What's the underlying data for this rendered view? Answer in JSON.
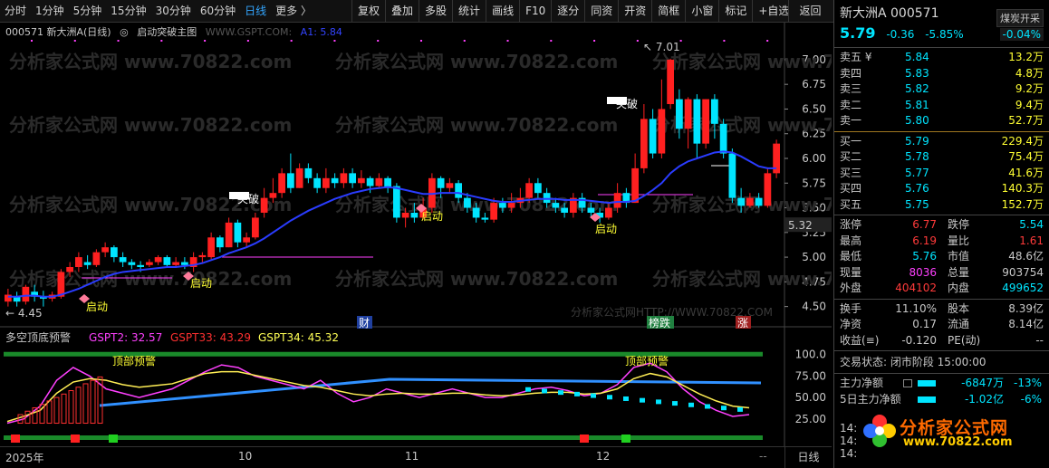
{
  "toolbar": {
    "periods": [
      "分时",
      "1分钟",
      "5分钟",
      "15分钟",
      "30分钟",
      "60分钟",
      "日线",
      "更多 〉"
    ],
    "active_period": "日线",
    "buttons": [
      "复权",
      "叠加",
      "多股",
      "统计",
      "画线",
      "F10",
      "逐分",
      "同资",
      "开资",
      "简框",
      "小窗",
      "标记",
      "+自选"
    ],
    "back": "返回"
  },
  "main_chart": {
    "stock_label": "000571 新大洲A(日线)",
    "indicator_name": "启动突破主图",
    "indicator_src": "WWW.GSPT.COM:",
    "a1_label": "A1: 5.84",
    "y_ticks": [
      "7.00",
      "6.75",
      "6.50",
      "6.25",
      "6.00",
      "5.75",
      "5.50",
      "5.25",
      "5.00",
      "4.75",
      "4.50"
    ],
    "current_price_tag": "5.32",
    "high_mark": "7.01",
    "low_mark": "4.45",
    "annotations": [
      "突破",
      "突破",
      "启动",
      "启动",
      "启动",
      "启动"
    ],
    "event_tags": [
      "财",
      "榜跌",
      "涨"
    ],
    "watermark": "分析家公式网 www.70822.com",
    "watermark_small": "分析家公式网HTTP://WWW.70822.COM"
  },
  "sub_chart": {
    "name": "多空顶底预警",
    "gspt2": "GSPT2: 32.57",
    "gspt33": "GSPT33: 43.29",
    "gspt34": "GSPT34: 45.32",
    "y_ticks": [
      "100.0",
      "75.00",
      "50.00",
      "25.00"
    ],
    "warnings": [
      "顶部预警",
      "顶部预警"
    ]
  },
  "x_axis": [
    "2025年",
    "10",
    "11",
    "12"
  ],
  "x_right": "日线",
  "panel": {
    "name": "新大洲A 000571",
    "sector": "煤炭开采",
    "price": "5.79",
    "change": "-0.36",
    "change_pct": "-5.85%",
    "sector_pct": "-0.04%",
    "asks": [
      {
        "label": "卖五 ¥",
        "price": "5.84",
        "vol": "13.2万"
      },
      {
        "label": "卖四",
        "price": "5.83",
        "vol": "4.8万"
      },
      {
        "label": "卖三",
        "price": "5.82",
        "vol": "9.2万"
      },
      {
        "label": "卖二",
        "price": "5.81",
        "vol": "9.4万"
      },
      {
        "label": "卖一",
        "price": "5.80",
        "vol": "52.7万"
      }
    ],
    "bids": [
      {
        "label": "买一",
        "price": "5.79",
        "vol": "229.4万"
      },
      {
        "label": "买二",
        "price": "5.78",
        "vol": "75.4万"
      },
      {
        "label": "买三",
        "price": "5.77",
        "vol": "41.6万"
      },
      {
        "label": "买四",
        "price": "5.76",
        "vol": "140.3万"
      },
      {
        "label": "买五",
        "price": "5.75",
        "vol": "152.7万"
      }
    ],
    "stats": [
      {
        "l1": "涨停",
        "v1": "6.77",
        "l2": "跌停",
        "v2": "5.54"
      },
      {
        "l1": "最高",
        "v1": "6.19",
        "l2": "量比",
        "v2": "1.61"
      },
      {
        "l1": "最低",
        "v1": "5.76",
        "l2": "市值",
        "v2": "48.6亿"
      },
      {
        "l1": "现量",
        "v1": "8036",
        "l2": "总量",
        "v2": "903754"
      },
      {
        "l1": "外盘",
        "v1": "404102",
        "l2": "内盘",
        "v2": "499652"
      }
    ],
    "stats2": [
      {
        "l1": "换手",
        "v1": "11.10%",
        "l2": "股本",
        "v2": "8.39亿"
      },
      {
        "l1": "净资",
        "v1": "0.17",
        "l2": "流通",
        "v2": "8.14亿"
      },
      {
        "l1": "收益(≡)",
        "v1": "-0.120",
        "l2": "PE(动)",
        "v2": "--"
      }
    ],
    "trade_status": "交易状态: 闭市阶段 15:00:00",
    "flow1_label": "主力净额",
    "flow1_val": "-6847万",
    "flow1_pct": "-13%",
    "flow2_label": "5日主力净额",
    "flow2_val": "-1.02亿",
    "flow2_pct": "-6%",
    "logo_text": "分析家公式网",
    "logo_url": "www.70822.com",
    "time_stub1": "14:",
    "time_stub2": "14:",
    "time_stub3": "14:"
  },
  "chart_data": {
    "type": "candlestick",
    "ylim": [
      4.35,
      7.1
    ],
    "candles": [
      [
        4.55,
        4.62,
        4.5,
        4.68
      ],
      [
        4.6,
        4.55,
        4.5,
        4.65
      ],
      [
        4.55,
        4.7,
        4.52,
        4.72
      ],
      [
        4.65,
        4.6,
        4.55,
        4.72
      ],
      [
        4.6,
        4.58,
        4.5,
        4.66
      ],
      [
        4.58,
        4.62,
        4.55,
        4.65
      ],
      [
        4.6,
        4.85,
        4.58,
        4.88
      ],
      [
        4.85,
        4.9,
        4.8,
        4.95
      ],
      [
        4.9,
        5.0,
        4.85,
        5.05
      ],
      [
        4.95,
        4.92,
        4.88,
        5.02
      ],
      [
        4.92,
        5.05,
        4.9,
        5.08
      ],
      [
        5.05,
        5.1,
        5.0,
        5.15
      ],
      [
        5.1,
        5.0,
        4.95,
        5.12
      ],
      [
        5.0,
        4.95,
        4.9,
        5.05
      ],
      [
        4.95,
        4.92,
        4.88,
        4.98
      ],
      [
        4.92,
        4.9,
        4.85,
        4.96
      ],
      [
        4.92,
        4.95,
        4.9,
        4.98
      ],
      [
        4.95,
        5.0,
        4.92,
        5.02
      ],
      [
        5.0,
        4.92,
        4.9,
        5.02
      ],
      [
        4.92,
        4.95,
        4.9,
        5.0
      ],
      [
        4.95,
        4.92,
        4.88,
        5.0
      ],
      [
        4.9,
        5.0,
        4.85,
        5.05
      ],
      [
        5.0,
        5.02,
        4.95,
        5.05
      ],
      [
        5.0,
        5.2,
        4.98,
        5.25
      ],
      [
        5.2,
        5.1,
        5.05,
        5.22
      ],
      [
        5.1,
        5.35,
        5.1,
        5.4
      ],
      [
        5.35,
        5.15,
        5.1,
        5.38
      ],
      [
        5.15,
        5.2,
        5.1,
        5.25
      ],
      [
        5.2,
        5.4,
        5.18,
        5.45
      ],
      [
        5.45,
        5.6,
        5.4,
        5.7
      ],
      [
        5.6,
        5.65,
        5.55,
        5.8
      ],
      [
        5.65,
        5.85,
        5.6,
        5.9
      ],
      [
        5.85,
        5.7,
        5.65,
        6.05
      ],
      [
        5.7,
        5.9,
        5.7,
        5.95
      ],
      [
        5.9,
        5.8,
        5.75,
        5.95
      ],
      [
        5.8,
        5.7,
        5.65,
        5.85
      ],
      [
        5.7,
        5.8,
        5.65,
        5.9
      ],
      [
        5.8,
        5.75,
        5.7,
        5.85
      ],
      [
        5.75,
        5.85,
        5.7,
        5.9
      ],
      [
        5.85,
        5.75,
        5.7,
        5.9
      ],
      [
        5.75,
        5.8,
        5.7,
        5.88
      ],
      [
        5.8,
        5.72,
        5.65,
        5.82
      ],
      [
        5.72,
        5.8,
        5.7,
        5.85
      ],
      [
        5.8,
        5.7,
        5.65,
        5.82
      ],
      [
        5.72,
        5.4,
        5.35,
        5.75
      ],
      [
        5.4,
        5.45,
        5.3,
        5.5
      ],
      [
        5.45,
        5.4,
        5.35,
        5.55
      ],
      [
        5.4,
        5.5,
        5.38,
        5.6
      ],
      [
        5.5,
        5.8,
        5.45,
        5.85
      ],
      [
        5.8,
        5.7,
        5.6,
        5.82
      ],
      [
        5.7,
        5.75,
        5.65,
        5.8
      ],
      [
        5.75,
        5.6,
        5.55,
        5.78
      ],
      [
        5.6,
        5.5,
        5.45,
        5.65
      ],
      [
        5.5,
        5.4,
        5.35,
        5.55
      ],
      [
        5.4,
        5.38,
        5.35,
        5.45
      ],
      [
        5.38,
        5.55,
        5.35,
        5.6
      ],
      [
        5.55,
        5.5,
        5.45,
        5.6
      ],
      [
        5.5,
        5.55,
        5.45,
        5.65
      ],
      [
        5.55,
        5.6,
        5.5,
        5.7
      ],
      [
        5.6,
        5.75,
        5.55,
        5.8
      ],
      [
        5.75,
        5.65,
        5.6,
        5.8
      ],
      [
        5.65,
        5.55,
        5.5,
        5.7
      ],
      [
        5.55,
        5.5,
        5.45,
        5.6
      ],
      [
        5.5,
        5.45,
        5.4,
        5.55
      ],
      [
        5.45,
        5.6,
        5.4,
        5.65
      ],
      [
        5.6,
        5.5,
        5.45,
        5.65
      ],
      [
        5.5,
        5.45,
        5.4,
        5.55
      ],
      [
        5.45,
        5.4,
        5.35,
        5.5
      ],
      [
        5.4,
        5.5,
        5.38,
        5.55
      ],
      [
        5.5,
        5.65,
        5.45,
        5.75
      ],
      [
        5.65,
        5.55,
        5.5,
        5.7
      ],
      [
        5.55,
        5.9,
        5.55,
        6.05
      ],
      [
        5.9,
        6.4,
        5.85,
        6.55
      ],
      [
        6.4,
        6.05,
        6.0,
        6.5
      ],
      [
        6.05,
        6.5,
        6.0,
        6.8
      ],
      [
        6.55,
        7.0,
        6.5,
        7.01
      ],
      [
        6.6,
        6.3,
        6.2,
        6.7
      ],
      [
        6.3,
        6.6,
        6.1,
        6.62
      ],
      [
        6.6,
        6.15,
        6.0,
        6.65
      ],
      [
        6.15,
        6.6,
        6.1,
        6.6
      ],
      [
        6.6,
        6.35,
        6.2,
        6.65
      ],
      [
        6.35,
        6.05,
        6.0,
        6.4
      ],
      [
        6.05,
        5.6,
        5.55,
        6.1
      ],
      [
        5.6,
        5.52,
        5.45,
        5.7
      ],
      [
        5.52,
        5.6,
        5.5,
        5.65
      ],
      [
        5.6,
        5.52,
        5.5,
        5.65
      ],
      [
        5.52,
        5.85,
        5.5,
        5.9
      ],
      [
        5.85,
        6.15,
        5.8,
        6.19
      ]
    ],
    "ma": [
      4.6,
      4.6,
      4.61,
      4.61,
      4.6,
      4.6,
      4.62,
      4.65,
      4.68,
      4.72,
      4.76,
      4.8,
      4.83,
      4.85,
      4.86,
      4.87,
      4.88,
      4.89,
      4.9,
      4.9,
      4.91,
      4.92,
      4.94,
      4.97,
      5.0,
      5.04,
      5.07,
      5.1,
      5.14,
      5.19,
      5.25,
      5.31,
      5.37,
      5.42,
      5.47,
      5.51,
      5.55,
      5.59,
      5.62,
      5.65,
      5.67,
      5.69,
      5.7,
      5.71,
      5.7,
      5.68,
      5.66,
      5.64,
      5.64,
      5.65,
      5.65,
      5.65,
      5.63,
      5.61,
      5.59,
      5.57,
      5.56,
      5.56,
      5.57,
      5.58,
      5.59,
      5.59,
      5.59,
      5.58,
      5.58,
      5.58,
      5.57,
      5.56,
      5.55,
      5.56,
      5.56,
      5.57,
      5.62,
      5.68,
      5.75,
      5.85,
      5.92,
      5.97,
      6.0,
      6.03,
      6.06,
      6.07,
      6.06,
      6.02,
      5.97,
      5.92,
      5.9,
      5.9
    ]
  }
}
